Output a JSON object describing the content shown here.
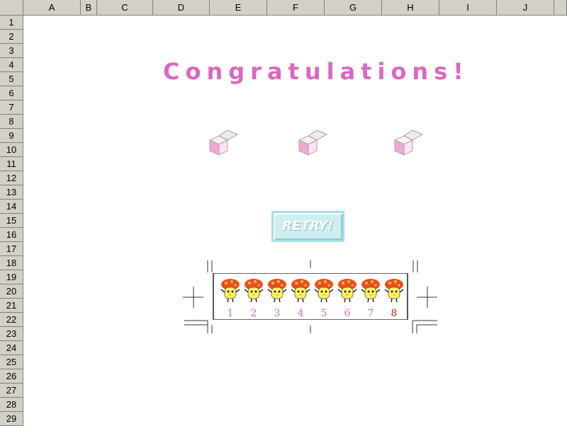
{
  "spreadsheet": {
    "columns": [
      "A",
      "B",
      "C",
      "D",
      "E",
      "F",
      "G",
      "H",
      "I",
      "J"
    ],
    "rows": [
      "1",
      "2",
      "3",
      "4",
      "5",
      "6",
      "7",
      "8",
      "9",
      "10",
      "11",
      "12",
      "13",
      "14",
      "15",
      "16",
      "17",
      "18",
      "19",
      "20",
      "21",
      "22",
      "23",
      "24",
      "25",
      "26",
      "27",
      "28",
      "29"
    ]
  },
  "title": "Congratulations!",
  "retry_label": "RETRY!",
  "characters": [
    {
      "number": "1"
    },
    {
      "number": "2"
    },
    {
      "number": "3"
    },
    {
      "number": "4"
    },
    {
      "number": "5"
    },
    {
      "number": "6"
    },
    {
      "number": "7"
    },
    {
      "number": "8"
    }
  ],
  "selected_number": "8",
  "colors": {
    "title": "#d869c0",
    "number": "#d869c0",
    "selected_number": "#e01818",
    "box_pink": "#f5b8dc",
    "retry_bg": "#cfeef2",
    "header_bg": "#d4d0c8"
  },
  "icons": [
    "open-gift-box-icon",
    "mushroom-cap-chick-icon"
  ]
}
